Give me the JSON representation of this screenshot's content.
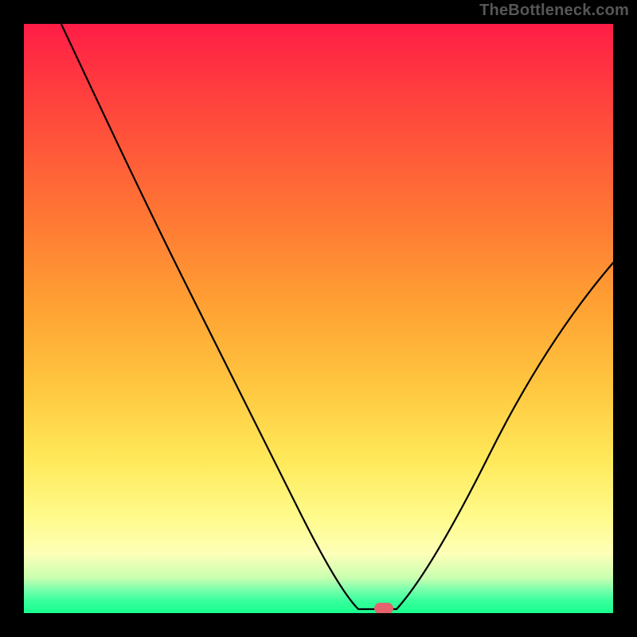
{
  "watermark": "TheBottleneck.com",
  "colors": {
    "frame": "#000000",
    "gradient_top": "#ff1d46",
    "gradient_bottom": "#1aff8f",
    "curve": "#000000",
    "marker": "#e4636d"
  },
  "chart_data": {
    "type": "line",
    "title": "",
    "xlabel": "",
    "ylabel": "",
    "xlim": [
      0,
      100
    ],
    "ylim": [
      0,
      100
    ],
    "x": [
      0,
      3,
      6,
      9,
      12,
      15,
      18,
      21,
      24,
      27,
      30,
      33,
      36,
      39,
      42,
      45,
      48,
      51,
      54,
      56,
      58,
      60,
      62,
      66,
      70,
      74,
      78,
      82,
      86,
      90,
      94,
      98,
      100
    ],
    "values": [
      106,
      99,
      92,
      85,
      79,
      73,
      67,
      61,
      55,
      49,
      43,
      38,
      33,
      28,
      23,
      18,
      14,
      10,
      6,
      3,
      1,
      0,
      0,
      3,
      9,
      16,
      24,
      32,
      40,
      47,
      53,
      58,
      60
    ],
    "marker": {
      "x": 61,
      "y": 0,
      "shape": "rounded-rect"
    },
    "notes": "Axes are unlabeled; values are relative percentages estimated from pixel positions. Minimum of the curve and the marker sit at roughly x≈61%."
  }
}
